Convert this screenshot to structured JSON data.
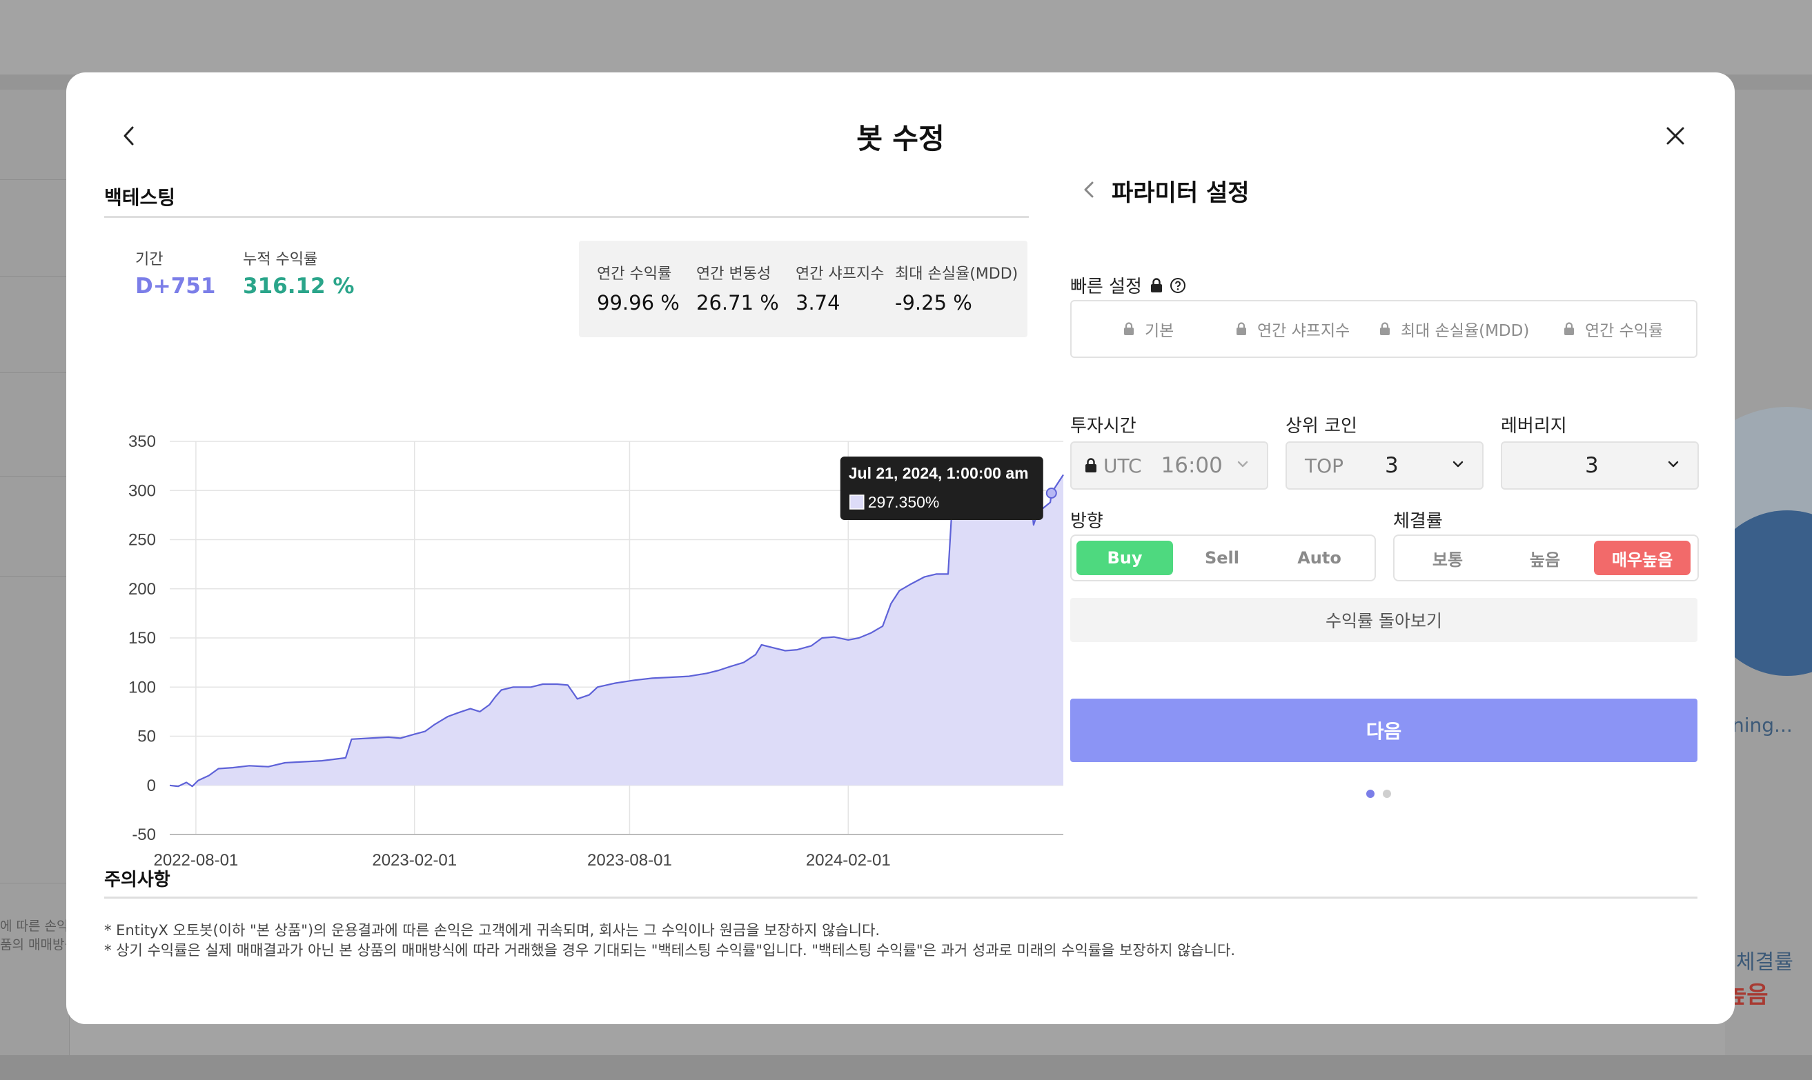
{
  "background": {
    "left_text": [
      "에 따른 손익",
      "품의 매매방식"
    ],
    "running_text": "ning...",
    "right_label": "체결률",
    "right_value": "높음"
  },
  "modal": {
    "title": "봇 수정",
    "backtest": {
      "heading": "백테스팅",
      "period_label": "기간",
      "period_value": "D+751",
      "cum_return_label": "누적 수익률",
      "cum_return_value": "316.12 %",
      "stats": [
        {
          "label": "연간 수익률",
          "value": "99.96 %"
        },
        {
          "label": "연간 변동성",
          "value": "26.71 %"
        },
        {
          "label": "연간 샤프지수",
          "value": "3.74"
        },
        {
          "label": "최대 손실율(MDD)",
          "value": "-9.25 %"
        }
      ],
      "tooltip": {
        "date": "Jul 21, 2024, 1:00:00 am",
        "value": "297.350%"
      }
    },
    "params": {
      "title": "파라미터 설정",
      "quick_label": "빠른 설정",
      "quick_options": [
        "기본",
        "연간 샤프지수",
        "최대 손실율(MDD)",
        "연간 수익률"
      ],
      "invest_time_label": "투자시간",
      "invest_time_prefix": "UTC",
      "invest_time_value": "16:00",
      "top_coin_label": "상위 코인",
      "top_coin_prefix": "TOP",
      "top_coin_value": "3",
      "leverage_label": "레버리지",
      "leverage_value": "3",
      "direction_label": "방향",
      "direction_options": [
        "Buy",
        "Sell",
        "Auto"
      ],
      "direction_selected": "Buy",
      "fill_rate_label": "체결률",
      "fill_rate_options": [
        "보통",
        "높음",
        "매우높음"
      ],
      "fill_rate_selected": "매우높음",
      "preview_button": "수익률 돌아보기",
      "next_button": "다음"
    },
    "notice": {
      "heading": "주의사항",
      "lines": [
        "* EntityX 오토봇(이하 \"본 상품\")의 운용결과에 따른 손익은 고객에게 귀속되며, 회사는 그 수익이나 원금을 보장하지 않습니다.",
        "* 상기 수익률은 실제 매매결과가 아닌 본 상품의 매매방식에 따라 거래했을 경우 기대되는 \"백테스팅 수익률\"입니다. \"백테스팅 수익률\"은 과거 성과로 미래의 수익률을 보장하지 않습니다."
      ]
    }
  },
  "colors": {
    "accent": "#8b94f5",
    "period": "#7b7ee8",
    "cum_return": "#2aa58a",
    "buy_on": "#4ed97f",
    "fill_on": "#f26a6a",
    "series_line": "#5e62d8",
    "series_fill": "#dddcf8"
  },
  "chart_data": {
    "type": "area",
    "title": "",
    "xlabel": "",
    "ylabel": "",
    "ylim": [
      -50,
      350
    ],
    "yticks": [
      350,
      300,
      250,
      200,
      150,
      100,
      50,
      0,
      -50
    ],
    "xlim": [
      "2022-07-10",
      "2024-07-31"
    ],
    "xticks": [
      "2022-08-01",
      "2023-02-01",
      "2023-08-01",
      "2024-02-01"
    ],
    "grid": true,
    "series": [
      {
        "name": "",
        "points": [
          [
            "2022-07-10",
            0
          ],
          [
            "2022-07-17",
            -1
          ],
          [
            "2022-07-24",
            3
          ],
          [
            "2022-07-29",
            -1
          ],
          [
            "2022-08-03",
            5
          ],
          [
            "2022-08-12",
            10
          ],
          [
            "2022-08-20",
            17
          ],
          [
            "2022-09-01",
            18
          ],
          [
            "2022-09-15",
            20
          ],
          [
            "2022-10-01",
            19
          ],
          [
            "2022-10-15",
            23
          ],
          [
            "2022-11-15",
            25
          ],
          [
            "2022-12-05",
            28
          ],
          [
            "2022-12-10",
            47
          ],
          [
            "2022-12-25",
            48
          ],
          [
            "2023-01-10",
            49
          ],
          [
            "2023-01-20",
            48
          ],
          [
            "2023-02-01",
            52
          ],
          [
            "2023-02-10",
            55
          ],
          [
            "2023-02-18",
            62
          ],
          [
            "2023-03-01",
            70
          ],
          [
            "2023-03-10",
            74
          ],
          [
            "2023-03-20",
            78
          ],
          [
            "2023-03-28",
            75
          ],
          [
            "2023-04-05",
            82
          ],
          [
            "2023-04-10",
            90
          ],
          [
            "2023-04-15",
            97
          ],
          [
            "2023-04-25",
            100
          ],
          [
            "2023-05-10",
            100
          ],
          [
            "2023-05-20",
            103
          ],
          [
            "2023-06-01",
            103
          ],
          [
            "2023-06-10",
            102
          ],
          [
            "2023-06-18",
            88
          ],
          [
            "2023-06-28",
            92
          ],
          [
            "2023-07-05",
            100
          ],
          [
            "2023-07-20",
            104
          ],
          [
            "2023-08-05",
            107
          ],
          [
            "2023-08-20",
            109
          ],
          [
            "2023-09-05",
            110
          ],
          [
            "2023-09-20",
            111
          ],
          [
            "2023-10-05",
            114
          ],
          [
            "2023-10-15",
            117
          ],
          [
            "2023-10-25",
            121
          ],
          [
            "2023-11-05",
            125
          ],
          [
            "2023-11-15",
            133
          ],
          [
            "2023-11-20",
            143
          ],
          [
            "2023-11-30",
            140
          ],
          [
            "2023-12-10",
            137
          ],
          [
            "2023-12-20",
            138
          ],
          [
            "2024-01-01",
            142
          ],
          [
            "2024-01-10",
            150
          ],
          [
            "2024-01-20",
            151
          ],
          [
            "2024-02-01",
            148
          ],
          [
            "2024-02-10",
            150
          ],
          [
            "2024-02-20",
            155
          ],
          [
            "2024-03-01",
            162
          ],
          [
            "2024-03-08",
            185
          ],
          [
            "2024-03-15",
            198
          ],
          [
            "2024-03-25",
            205
          ],
          [
            "2024-04-05",
            212
          ],
          [
            "2024-04-15",
            215
          ],
          [
            "2024-04-25",
            215
          ],
          [
            "2024-04-28",
            276
          ],
          [
            "2024-05-10",
            277
          ],
          [
            "2024-05-25",
            280
          ],
          [
            "2024-06-10",
            285
          ],
          [
            "2024-06-20",
            287
          ],
          [
            "2024-06-28",
            300
          ],
          [
            "2024-07-03",
            300
          ],
          [
            "2024-07-06",
            265
          ],
          [
            "2024-07-10",
            280
          ],
          [
            "2024-07-14",
            282
          ],
          [
            "2024-07-17",
            285
          ],
          [
            "2024-07-20",
            288
          ],
          [
            "2024-07-21",
            297.35
          ],
          [
            "2024-07-25",
            305
          ],
          [
            "2024-07-31",
            316
          ]
        ]
      }
    ],
    "highlight": {
      "date": "2024-07-21",
      "value": 297.35
    }
  }
}
